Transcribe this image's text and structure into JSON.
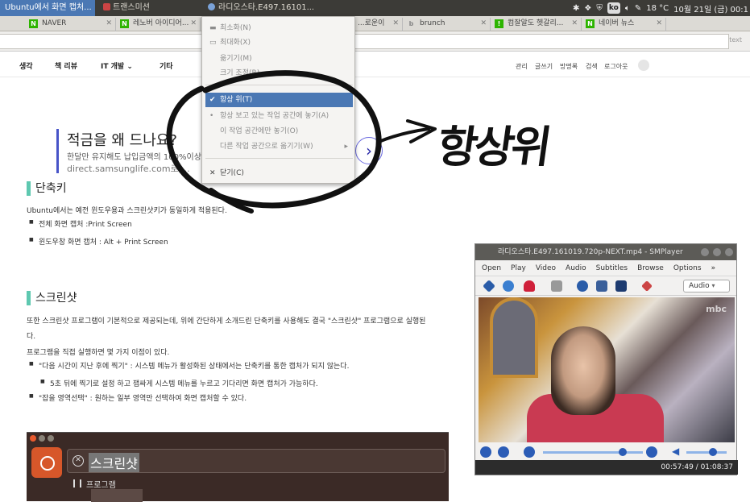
{
  "topbar": {
    "tasks": [
      {
        "label": "Ubuntu에서 화면 캡처...",
        "active": true
      },
      {
        "label": "트랜스미션",
        "active": false
      },
      {
        "label": "라디오스타.E497.16101...",
        "active": false
      }
    ],
    "tray": {
      "ime": "ko",
      "weather": "18 °C",
      "clock": "10월 21일 (금) 00:1"
    }
  },
  "tabs": [
    {
      "label": "NAVER",
      "favicon": "N",
      "favicon_color": "#2db400"
    },
    {
      "label": "레노버 아이디어...",
      "favicon": "N",
      "favicon_color": "#2db400"
    },
    {
      "label": "...로운이",
      "favicon": "",
      "favicon_color": ""
    },
    {
      "label": "brunch",
      "favicon": "b",
      "favicon_color": "#888888"
    },
    {
      "label": "컴잘알도 헷갈리...",
      "favicon": "!",
      "favicon_color": "#2db400"
    },
    {
      "label": "네이버 뉴스",
      "favicon": "N",
      "favicon_color": "#2db400"
    }
  ],
  "urlbar": {
    "right": "text"
  },
  "site_nav": {
    "items": [
      "생각",
      "책 리뷰",
      "IT 개발",
      "기타"
    ],
    "right": [
      "관리",
      "글쓰기",
      "방명록",
      "검색",
      "로그아웃"
    ]
  },
  "ad": {
    "headline": "적금을 왜 드나요?",
    "sub": "한달만 유지해도 납입금액의 100%이상",
    "url": "direct.samsunglife.com로 ...",
    "next": "›"
  },
  "article": {
    "sec1_title": "단축키",
    "p1": "Ubuntu에서는 예전 윈도우용과 스크린샷키가 동일하게 적용된다.",
    "b1": "전체 화면 캡처 :Print Screen",
    "b2": "윈도우창 화면 캡처 : Alt + Print Screen",
    "sec2_title": "스크린샷",
    "p2": "또한 스크린샷 프로그램이 기본적으로 제공되는데, 위에 간단하게 소개드린 단축키를 사용해도 결국 \"스크린샷\" 프로그램으로 실행된",
    "p2b": "다.",
    "p3": "프로그램을 직접 실행하면 몇 가지 이점이 있다.",
    "b3": "\"다음 시간이 지난 후에 찍기\" : 시스템 메뉴가 활성화된 상태에서는 단축키를 통한 캡처가 되지 않는다.",
    "b4": "5초 뒤에 찍기로 설정 하고 잽싸게 시스템 메뉴를 누르고 기다리면 화면 캡처가 가능하다.",
    "b5": "\"잡을 영역선택\" : 원하는 일부 영역만 선택하여 화면 캡처할 수 있다."
  },
  "terminal": {
    "search_text": "스크린샷",
    "section": "프로그램"
  },
  "player": {
    "title": "라디오스타.E497.161019.720p-NEXT.mp4 - SMPlayer",
    "menu": [
      "Open",
      "Play",
      "Video",
      "Audio",
      "Subtitles",
      "Browse",
      "Options",
      "»"
    ],
    "audio_label": "Audio",
    "video_logo": "mbc",
    "time": "00:57:49 / 01:08:37"
  },
  "context_menu": {
    "items": [
      {
        "label": "최소화(N)",
        "mark": "▬",
        "state": "normal"
      },
      {
        "label": "최대화(X)",
        "mark": "▭",
        "state": "normal"
      },
      {
        "label": "옮기기(M)",
        "mark": "",
        "state": "normal"
      },
      {
        "label": "크기 조정(R)",
        "mark": "",
        "state": "normal"
      },
      {
        "label": "항상 위(T)",
        "mark": "✔",
        "state": "selected"
      },
      {
        "label": "항상 보고 있는 작업 공간에 놓기(A)",
        "mark": "•",
        "state": "normal"
      },
      {
        "label": "이 작업 공간에만 놓기(O)",
        "mark": "",
        "state": "normal"
      },
      {
        "label": "다른 작업 공간으로 옮기기(W)",
        "mark": "",
        "state": "submenu",
        "arrow": "▸"
      },
      {
        "label": "닫기(C)",
        "mark": "✕",
        "state": "normal"
      }
    ]
  },
  "annotation": {
    "text": "항상위"
  }
}
